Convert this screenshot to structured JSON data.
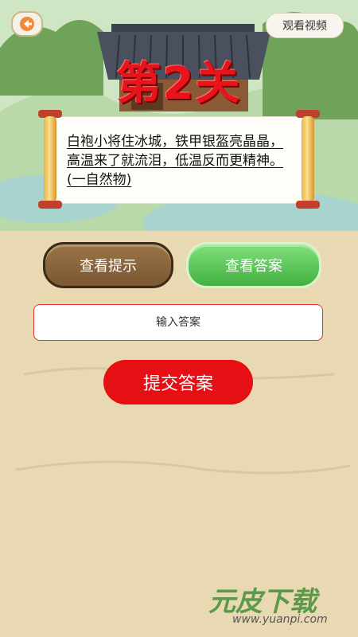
{
  "header": {
    "back_icon": "back-arrow-icon",
    "watch_video_label": "观看视频"
  },
  "level": {
    "title": "第2关"
  },
  "riddle": {
    "text": "白袍小将住冰城，铁甲银盔亮晶晶，高温来了就流泪，低温反而更精神。(一自然物)"
  },
  "actions": {
    "hint_label": "查看提示",
    "answer_label": "查看答案",
    "submit_label": "提交答案"
  },
  "answer_input": {
    "placeholder": "输入答案",
    "value": ""
  },
  "watermark": {
    "brand": "元皮下载",
    "url": "www.yuanpi.com"
  },
  "colors": {
    "title_red": "#e8141c",
    "hint_brown": "#8a6a3e",
    "answer_green": "#5cc65a",
    "submit_red": "#e60f14"
  }
}
